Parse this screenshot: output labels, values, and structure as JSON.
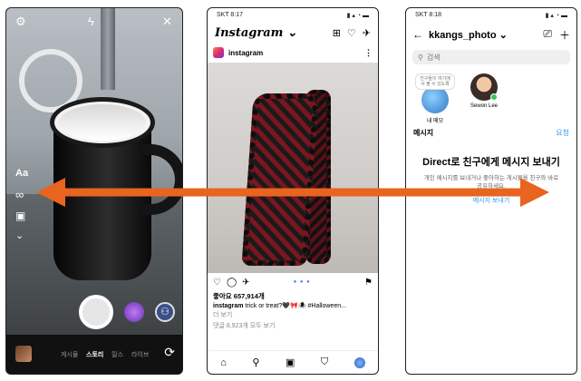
{
  "camera": {
    "side_text_label": "Aa",
    "side_boomerang": "∞",
    "side_layout": "▣",
    "side_more": "⌄",
    "modes": [
      "게시물",
      "스토리",
      "릴스",
      "라이브"
    ],
    "active_mode": "스토리"
  },
  "feed": {
    "status_time": "SKT 8:17",
    "logo": "Instagram ⌄",
    "post_user": "instagram",
    "likes": "좋아요 657,914개",
    "caption_user": "instagram",
    "caption_text": "trick or treat?🖤🎀🕷 #Halloween...",
    "more": "더 보기",
    "comments": "댓글 8,923개 모두 보기"
  },
  "direct": {
    "status_time": "SKT 8:18",
    "title": "kkangs_photo ⌄",
    "search_placeholder": "검색",
    "note_bubble": "친구들이 여기에서 볼 수 있도록",
    "note_label": "내 메모",
    "friend_label": "Sewon Lee",
    "messages_label": "메시지",
    "requests_label": "요청",
    "empty_title": "Direct로 친구에게 메시지 보내기",
    "empty_desc": "개인 메시지를 보내거나 좋아하는 게시물을 친구와 바로 공유하세요.",
    "send_link": "메시지 보내기"
  },
  "colors": {
    "arrow": "#e8641f",
    "link": "#3897f0"
  }
}
